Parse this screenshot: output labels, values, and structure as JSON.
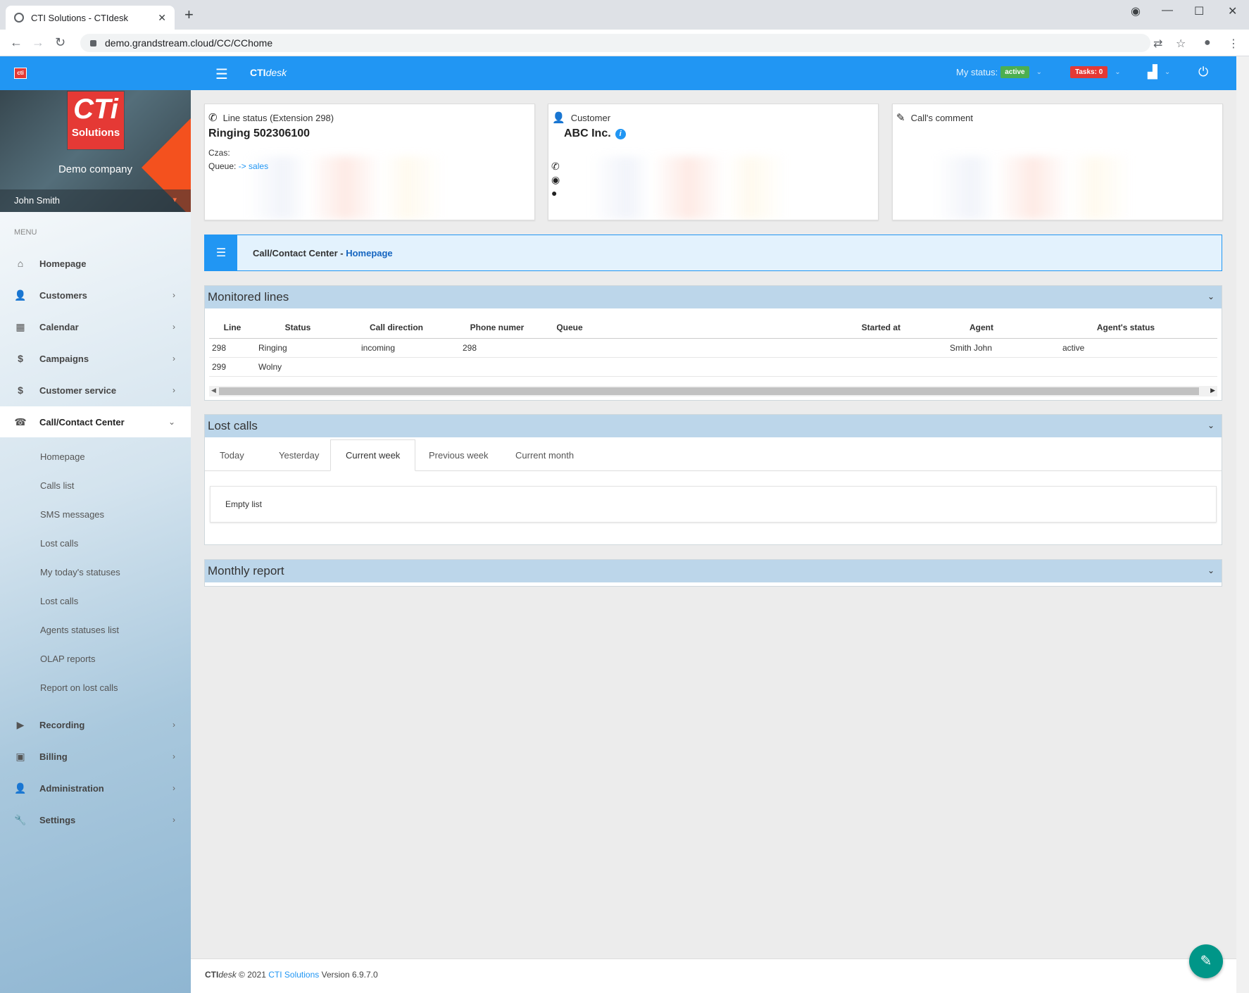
{
  "browser": {
    "tab_title": "CTI Solutions - CTIdesk",
    "url": "demo.grandstream.cloud/CC/CChome"
  },
  "header": {
    "brand_bold": "CTI",
    "brand_italic": "desk",
    "my_status_label": "My status:",
    "my_status_value": "active",
    "tasks_label": "Tasks: 0"
  },
  "sidebar": {
    "logo_big": "CTi",
    "logo_small": "Solutions",
    "company": "Demo company",
    "user": "John Smith",
    "menu_label": "MENU",
    "items": [
      {
        "label": "Homepage"
      },
      {
        "label": "Customers"
      },
      {
        "label": "Calendar"
      },
      {
        "label": "Campaigns"
      },
      {
        "label": "Customer service"
      },
      {
        "label": "Call/Contact Center"
      },
      {
        "label": "Recording"
      },
      {
        "label": "Billing"
      },
      {
        "label": "Administration"
      },
      {
        "label": "Settings"
      }
    ],
    "subitems": [
      {
        "label": "Homepage"
      },
      {
        "label": "Calls list"
      },
      {
        "label": "SMS messages"
      },
      {
        "label": "Lost calls"
      },
      {
        "label": "My today's statuses"
      },
      {
        "label": "Lost calls"
      },
      {
        "label": "Agents statuses list"
      },
      {
        "label": "OLAP reports"
      },
      {
        "label": "Report on lost calls"
      }
    ]
  },
  "line_status": {
    "heading": "Line status (Extension 298)",
    "title": "Ringing 502306100",
    "czas_label": "Czas:",
    "queue_label": "Queue:",
    "queue_link": "-> sales"
  },
  "customer": {
    "heading": "Customer",
    "name": "ABC Inc."
  },
  "comment": {
    "heading": "Call's comment"
  },
  "banner": {
    "section": "Call/Contact Center",
    "separator": " - ",
    "page": "Homepage"
  },
  "monitored": {
    "title": "Monitored lines",
    "columns": [
      "Line",
      "Status",
      "Call direction",
      "Phone numer",
      "Queue",
      "Started at",
      "Agent",
      "Agent's status"
    ],
    "rows": [
      [
        "298",
        "Ringing",
        "incoming",
        "298",
        "",
        "",
        "Smith John",
        "active"
      ],
      [
        "299",
        "Wolny",
        "",
        "",
        "",
        "",
        "",
        ""
      ]
    ]
  },
  "lost_calls": {
    "title": "Lost calls",
    "tabs": [
      "Today",
      "Yesterday",
      "Current week",
      "Previous week",
      "Current month"
    ],
    "active_tab": "Current week",
    "empty": "Empty list"
  },
  "monthly": {
    "title": "Monthly report"
  },
  "footer": {
    "brand_bold": "CTI",
    "brand_italic": "desk",
    "copyright": " © 2021 ",
    "company_link": "CTI Solutions",
    "version": " Version 6.9.7.0"
  },
  "colors": {
    "primary": "#2196f3",
    "status_active": "#4caf50",
    "tasks_badge": "#e53935",
    "fab": "#009688"
  }
}
